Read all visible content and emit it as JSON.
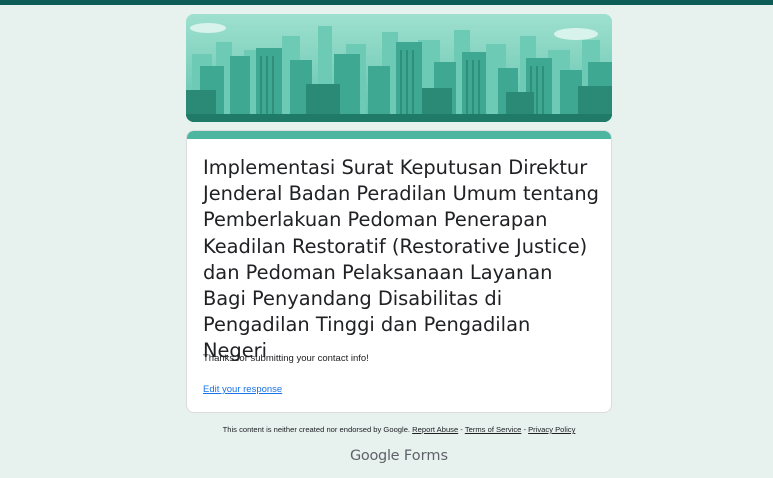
{
  "form": {
    "title": "Implementasi Surat Keputusan Direktur Jenderal Badan Peradilan Umum tentang Pemberlakuan Pedoman Penerapan Keadilan Restoratif (Restorative Justice) dan Pedoman Pelaksanaan Layanan Bagi Penyandang Disabilitas di Pengadilan Tinggi dan Pengadilan Negeri",
    "confirmation_message": "Thanks for submitting your contact info!",
    "edit_response_link": "Edit your response"
  },
  "footer": {
    "disclaimer": "This content is neither created nor endorsed by Google.",
    "report_abuse": "Report Abuse",
    "terms": "Terms of Service",
    "privacy": "Privacy Policy",
    "separator": " - ",
    "brand_google": "Google",
    "brand_forms": "Forms"
  },
  "colors": {
    "page_background": "#e7f2ef",
    "top_strip": "#0d5c55",
    "card_accent": "#4db6a0",
    "link": "#1a73e8"
  },
  "icons": {
    "banner": "city-skyline-illustration",
    "logo": "google-forms-logo"
  }
}
